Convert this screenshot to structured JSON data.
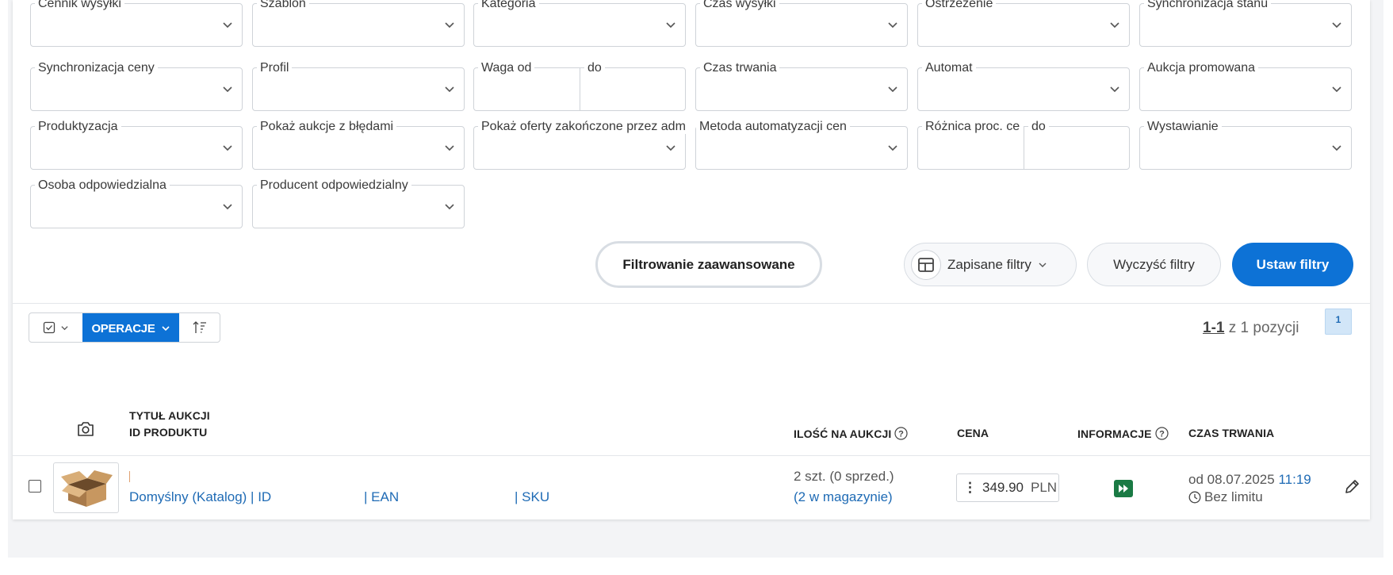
{
  "filters": {
    "row0": [
      "Cennik wysyłki",
      "Szablon",
      "Kategoria",
      "Czas wysyłki",
      "Ostrzeżenie",
      "Synchronizacja stanu"
    ],
    "row1": {
      "sync_price": "Synchronizacja ceny",
      "profile": "Profil",
      "weight_from": "Waga od",
      "weight_to": "do",
      "duration": "Czas trwania",
      "automat": "Automat",
      "promoted": "Aukcja promowana"
    },
    "row2": {
      "productization": "Produktyzacja",
      "errors": "Pokaż aukcje z błędami",
      "ended_by_admin": "Pokaż oferty zakończone przez adm",
      "price_automation": "Metoda automatyzacji cen",
      "percent_diff": "Różnica proc. ce",
      "percent_diff_to": "do",
      "listing": "Wystawianie"
    },
    "row3": {
      "responsible_person": "Osoba odpowiedzialna",
      "responsible_producer": "Producent odpowiedzialny"
    }
  },
  "actions": {
    "advanced": "Filtrowanie zaawansowane",
    "saved": "Zapisane filtry",
    "clear": "Wyczyść filtry",
    "apply": "Ustaw filtry"
  },
  "toolbar": {
    "operations": "OPERACJE",
    "range": "1-1",
    "of_total": "z 1 pozycji",
    "page": "1"
  },
  "table": {
    "headers": {
      "title": "TYTUŁ AUKCJI",
      "product_id": "ID PRODUKTU",
      "quantity": "ILOŚĆ NA AUKCJI",
      "price": "CENA",
      "info": "INFORMACJE",
      "duration": "CZAS TRWANIA"
    },
    "rows": [
      {
        "catalog": "Domyślny (Katalog) | ID",
        "ean": "| EAN",
        "sku": "| SKU",
        "qty": "2 szt. (0 sprzed.)",
        "stock": "(2 w magazynie)",
        "price": "349.90",
        "currency": "PLN",
        "date_prefix": "od 08.07.2025",
        "time": "11:19",
        "limit": "Bez limitu"
      }
    ]
  },
  "colors": {
    "primary": "#0d72d6",
    "link": "#1f6bb5",
    "info_icon": "#1a7a44"
  }
}
